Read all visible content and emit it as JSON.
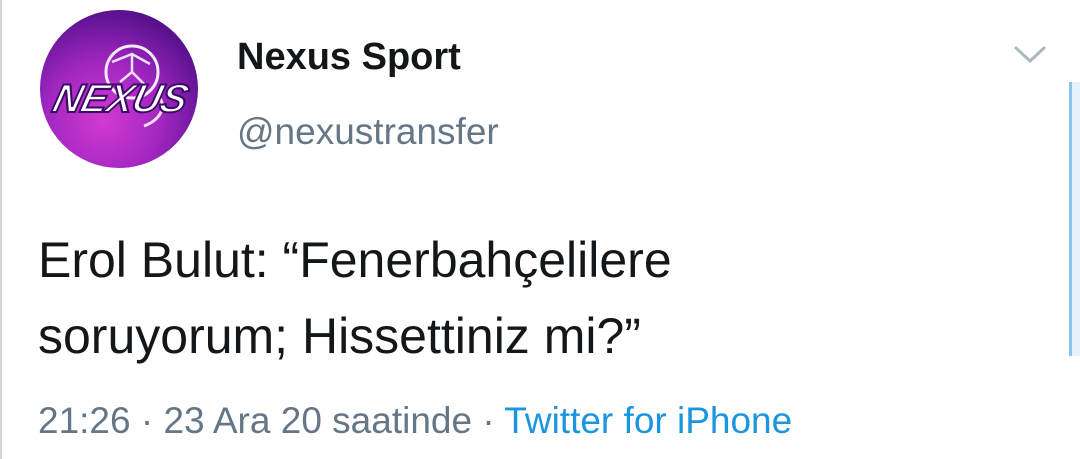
{
  "tweet": {
    "author": {
      "display_name": "Nexus Sport",
      "handle": "@nexustransfer",
      "avatar_text": "NEXUS",
      "avatar_icon": "nexus-logo"
    },
    "text_lines": [
      "Erol Bulut: “Fenerbahçelilere",
      "soruyorum; Hissettiniz mi?”"
    ],
    "meta": {
      "time": "21:26",
      "separator": "·",
      "date": "23 Ara 20 saatinde",
      "source": "Twitter for iPhone"
    },
    "more_icon": "chevron-down-icon"
  },
  "colors": {
    "text_primary": "#14171a",
    "text_secondary": "#657786",
    "link": "#1b95e0",
    "avatar_purple": "#a126c2"
  }
}
